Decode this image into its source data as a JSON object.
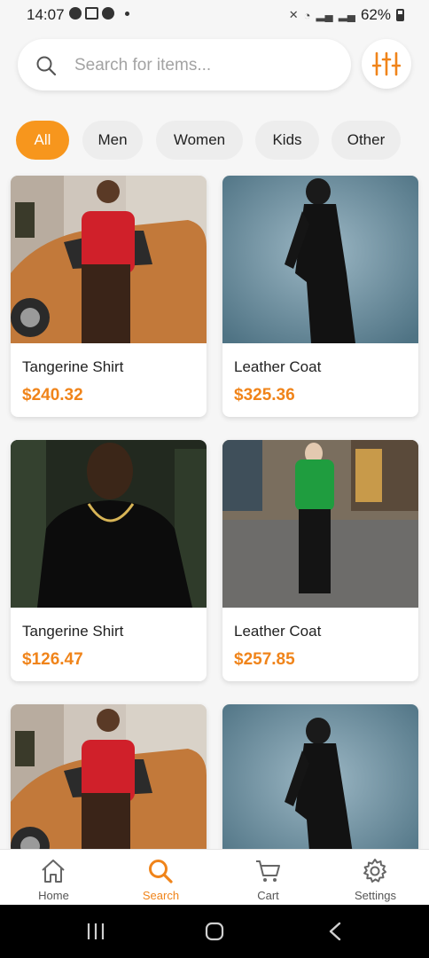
{
  "status_bar": {
    "time": "14:07",
    "battery": "62%"
  },
  "search": {
    "placeholder": "Search for items..."
  },
  "categories": [
    "All",
    "Men",
    "Women",
    "Kids",
    "Other"
  ],
  "active_category": "All",
  "products": [
    {
      "name": "Tangerine Shirt",
      "price": "$240.32",
      "image": "man-red-shirt-car"
    },
    {
      "name": "Leather Coat",
      "price": "$325.36",
      "image": "woman-black-coat-blue"
    },
    {
      "name": "Tangerine Shirt",
      "price": "$126.47",
      "image": "man-black-tshirt-chain"
    },
    {
      "name": "Leather Coat",
      "price": "$257.85",
      "image": "woman-green-cardigan-street"
    },
    {
      "name": "",
      "price": "",
      "image": "man-red-shirt-car"
    },
    {
      "name": "",
      "price": "",
      "image": "woman-black-coat-blue"
    }
  ],
  "nav": {
    "items": [
      {
        "label": "Home",
        "icon": "home-icon"
      },
      {
        "label": "Search",
        "icon": "search-icon"
      },
      {
        "label": "Cart",
        "icon": "cart-icon"
      },
      {
        "label": "Settings",
        "icon": "gear-icon"
      }
    ],
    "active": "Search"
  },
  "colors": {
    "accent": "#f7961d",
    "price": "#f0841a",
    "chip_bg": "#ededed"
  }
}
